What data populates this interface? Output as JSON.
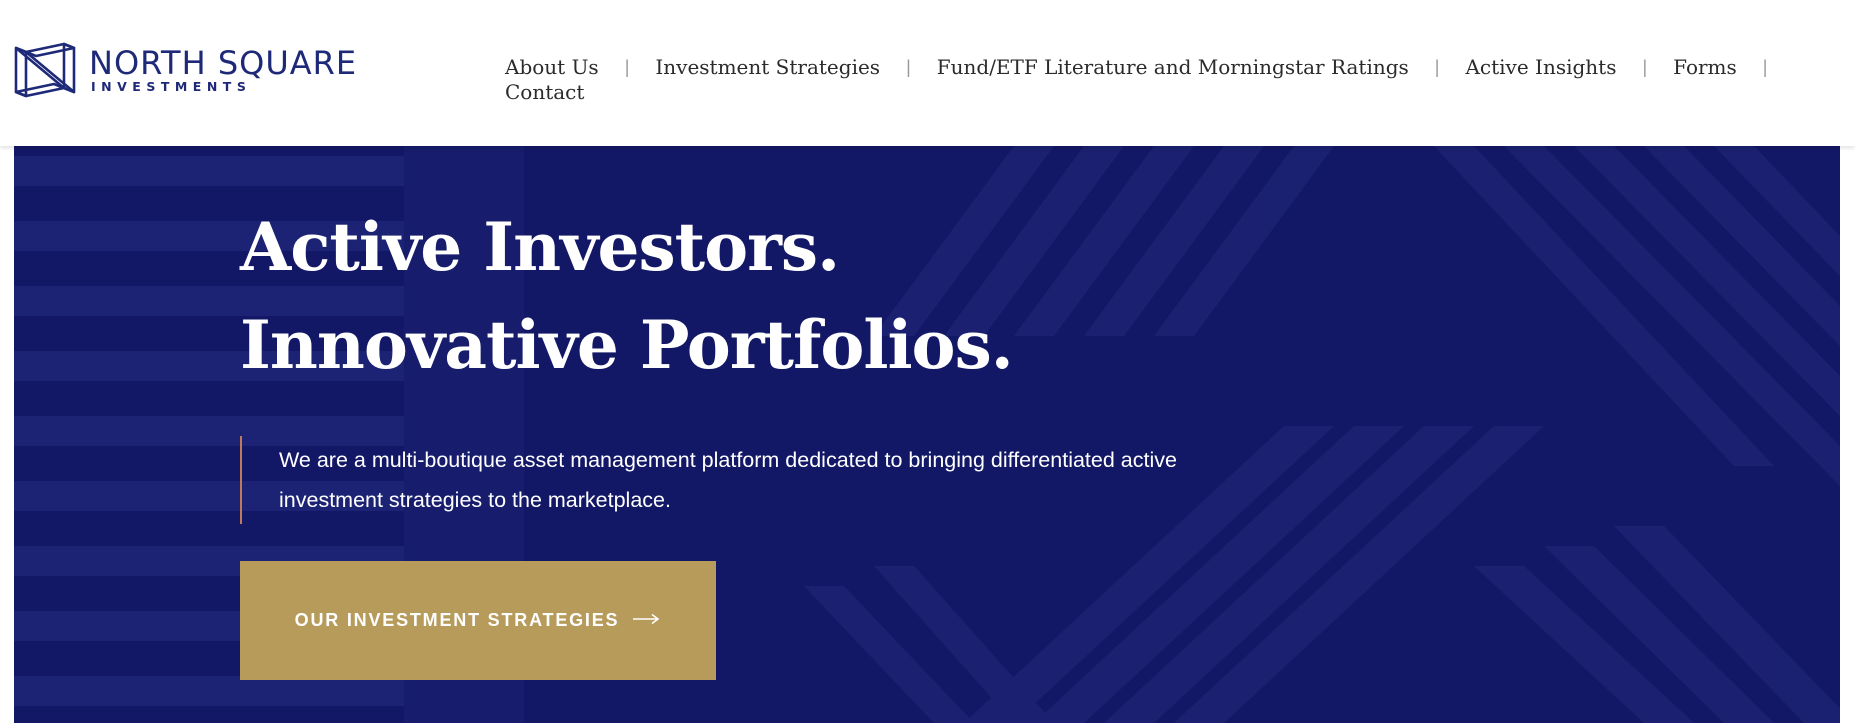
{
  "brand": {
    "name": "NORTH SQUARE",
    "tagline": "INVESTMENTS",
    "logo_color": "#1e2a78"
  },
  "nav": {
    "items": [
      {
        "label": "About Us"
      },
      {
        "label": "Investment Strategies"
      },
      {
        "label": "Fund/ETF Literature and Morningstar Ratings"
      },
      {
        "label": "Active Insights"
      },
      {
        "label": "Forms"
      },
      {
        "label": "Contact"
      }
    ],
    "separator": "|"
  },
  "hero": {
    "headline_line1": "Active Investors.",
    "headline_line2": "Innovative Portfolios.",
    "description": "We are a multi-boutique asset management platform dedicated to bringing differentiated active investment strategies to the marketplace.",
    "cta_label": "OUR INVESTMENT STRATEGIES",
    "cta_icon": "arrow-right-icon",
    "background_color": "#131866",
    "accent_color": "#b79b5b",
    "rule_color": "#c0795a"
  }
}
